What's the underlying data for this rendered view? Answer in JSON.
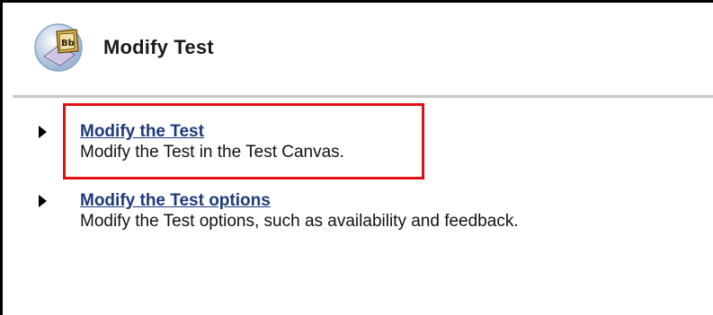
{
  "header": {
    "title": "Modify Test",
    "icon": "blackboard-test-icon"
  },
  "options": [
    {
      "link": "Modify the Test",
      "description": "Modify the Test in the Test Canvas.",
      "highlighted": true
    },
    {
      "link": "Modify the Test options",
      "description": "Modify the Test options, such as availability and feedback.",
      "highlighted": false
    }
  ],
  "colors": {
    "link": "#1f3a7a",
    "highlight_border": "#e01010",
    "divider": "#c8c8c8"
  }
}
